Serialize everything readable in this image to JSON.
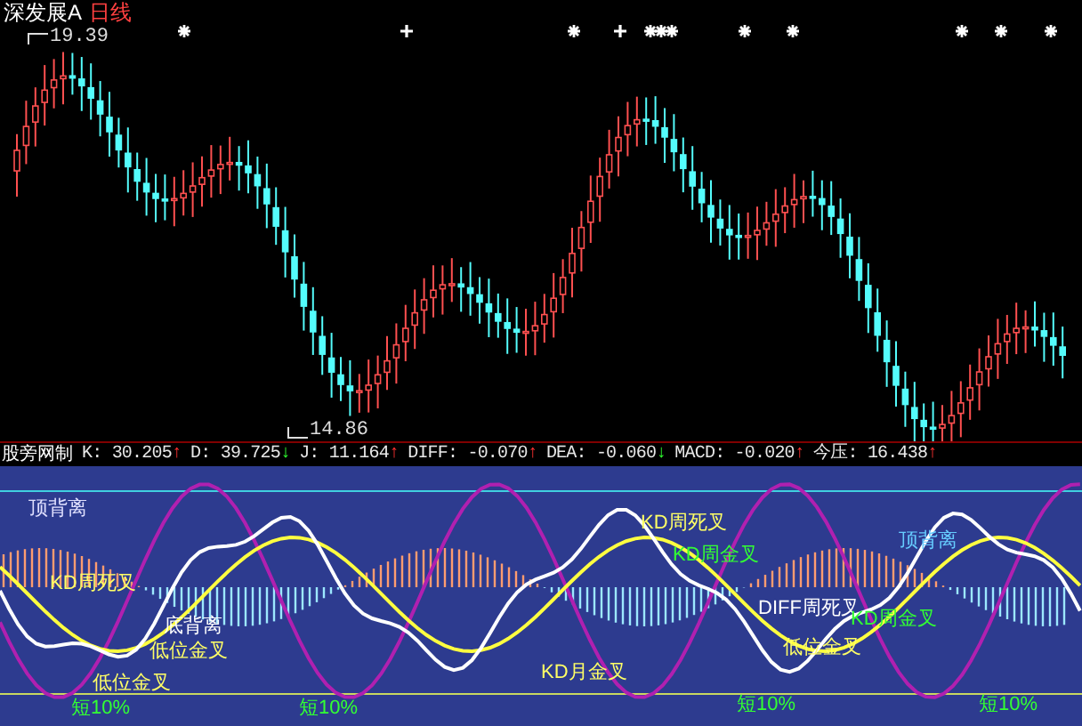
{
  "chart_title": {
    "name": "深发展A",
    "period": "日线"
  },
  "price_marks": [
    {
      "text": "19.39"
    },
    {
      "text": "14.86"
    }
  ],
  "indicator": {
    "name": "股旁网制",
    "readings": [
      {
        "label": "K:",
        "value": "30.205",
        "arrow": "↑",
        "rising": true
      },
      {
        "label": "D:",
        "value": "39.725",
        "arrow": "↓",
        "rising": false
      },
      {
        "label": "J:",
        "value": "11.164",
        "arrow": "↑",
        "rising": true
      },
      {
        "label": "DIFF:",
        "value": "-0.070",
        "arrow": "↑",
        "rising": true
      },
      {
        "label": "DEA:",
        "value": "-0.060",
        "arrow": "↓",
        "rising": false
      },
      {
        "label": "MACD:",
        "value": "-0.020",
        "arrow": "↑",
        "rising": true
      },
      {
        "label": "今压:",
        "value": "16.438",
        "arrow": "↑",
        "rising": true
      }
    ]
  },
  "signals": [
    {
      "text": "顶背离",
      "color": "#e0e0ff"
    },
    {
      "text": "KD周死叉",
      "color": "#ffff66"
    },
    {
      "text": "底背离",
      "color": "#ffffff"
    },
    {
      "text": "低位金叉",
      "color": "#ffff66"
    },
    {
      "text": "低位金叉",
      "color": "#ffff66"
    },
    {
      "text": "短10%",
      "color": "#33ff33"
    },
    {
      "text": "短10%",
      "color": "#33ff33"
    },
    {
      "text": "KD周死叉",
      "color": "#ffff66"
    },
    {
      "text": "KD周金叉",
      "color": "#33ff33"
    },
    {
      "text": "顶背离",
      "color": "#66ccff"
    },
    {
      "text": "DIFF周死叉",
      "color": "#ffffff"
    },
    {
      "text": "KD周金叉",
      "color": "#33ff33"
    },
    {
      "text": "低位金叉",
      "color": "#ffff66"
    },
    {
      "text": "KD月金叉",
      "color": "#ffff66"
    },
    {
      "text": "短10%",
      "color": "#33ff33"
    },
    {
      "text": "短10%",
      "color": "#33ff33"
    }
  ]
}
